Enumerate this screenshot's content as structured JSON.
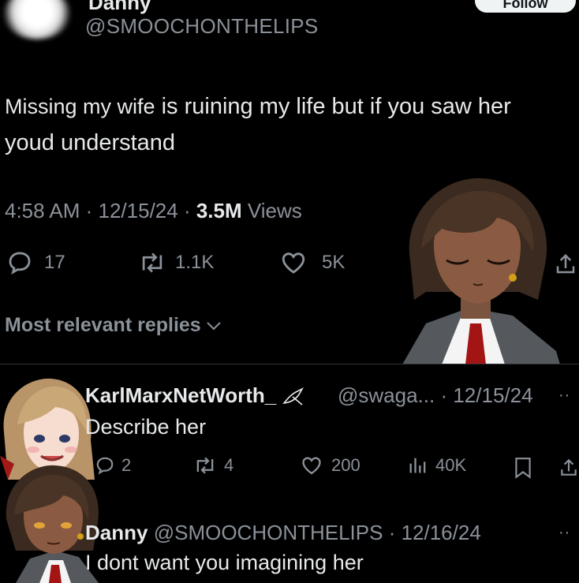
{
  "tweet": {
    "author_name": "Danny",
    "author_handle": "@SMOOCHONTHELIPS",
    "follow_label": "Follow",
    "text_part1": "Missing my wife",
    "text_part2": " is ruining my life but if you saw her youd understand",
    "time": "4:58 AM",
    "date": "12/15/24",
    "views_count": "3.5M",
    "views_label": "Views",
    "replies": "17",
    "reposts": "1.1K",
    "likes": "5K"
  },
  "replies_header": "Most relevant replies",
  "replies": [
    {
      "name": "KarlMarxNetWorth_",
      "handle": "@swaga...",
      "date": "12/15/24",
      "text": "Describe her",
      "replies": "2",
      "reposts": "4",
      "likes": "200",
      "views": "40K"
    },
    {
      "name": "Danny",
      "handle": "@SMOOCHONTHELIPS",
      "date": "12/16/24",
      "text": "I dont want you imagining her"
    }
  ],
  "colors": {
    "background": "#000000",
    "text_primary": "#e7e9ea",
    "text_secondary": "#8b9199",
    "divider": "#2f3336"
  }
}
